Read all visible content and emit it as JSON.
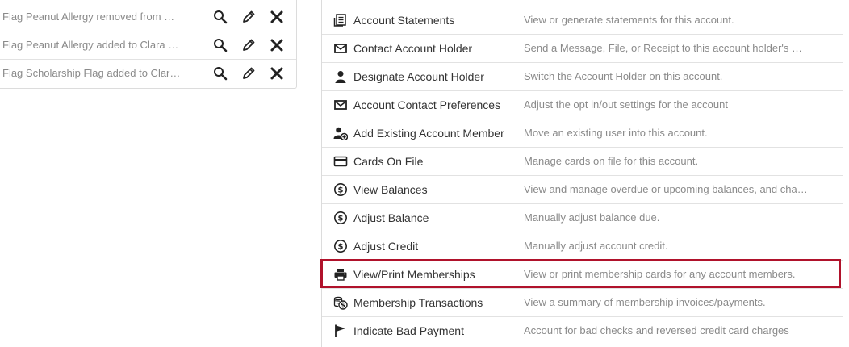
{
  "notes": [
    {
      "text": "Flag Peanut Allergy removed from Clar..."
    },
    {
      "text": "Flag Peanut Allergy added to Clara Sie..."
    },
    {
      "text": "Flag Scholarship Flag added to Clara Si..."
    }
  ],
  "actions": [
    {
      "label": "Account Statements",
      "desc": "View or generate statements for this account.",
      "icon": "statement-icon"
    },
    {
      "label": "Contact Account Holder",
      "desc": "Send a Message, File, or Receipt to this account holder's email ...",
      "icon": "envelope-icon"
    },
    {
      "label": "Designate Account Holder",
      "desc": "Switch the Account Holder on this account.",
      "icon": "user-icon"
    },
    {
      "label": "Account Contact Preferences",
      "desc": "Adjust the opt in/out settings for the account",
      "icon": "envelope-icon"
    },
    {
      "label": "Add Existing Account Member",
      "desc": "Move an existing user into this account.",
      "icon": "add-user-icon"
    },
    {
      "label": "Cards On File",
      "desc": "Manage cards on file for this account.",
      "icon": "credit-card-icon"
    },
    {
      "label": "View Balances",
      "desc": "View and manage overdue or upcoming balances, and change t...",
      "icon": "dollar-circle-icon"
    },
    {
      "label": "Adjust Balance",
      "desc": "Manually adjust balance due.",
      "icon": "dollar-circle-icon"
    },
    {
      "label": "Adjust Credit",
      "desc": "Manually adjust account credit.",
      "icon": "dollar-circle-icon"
    },
    {
      "label": "View/Print Memberships",
      "desc": "View or print membership cards for any account members.",
      "icon": "printer-icon"
    },
    {
      "label": "Membership Transactions",
      "desc": "View a summary of membership invoices/payments.",
      "icon": "coins-icon"
    },
    {
      "label": "Indicate Bad Payment",
      "desc": "Account for bad checks and reversed credit card charges",
      "icon": "flag-icon"
    }
  ],
  "colors": {
    "highlight": "#b0122b",
    "label": "#333333",
    "muted": "#8a8a8a"
  }
}
